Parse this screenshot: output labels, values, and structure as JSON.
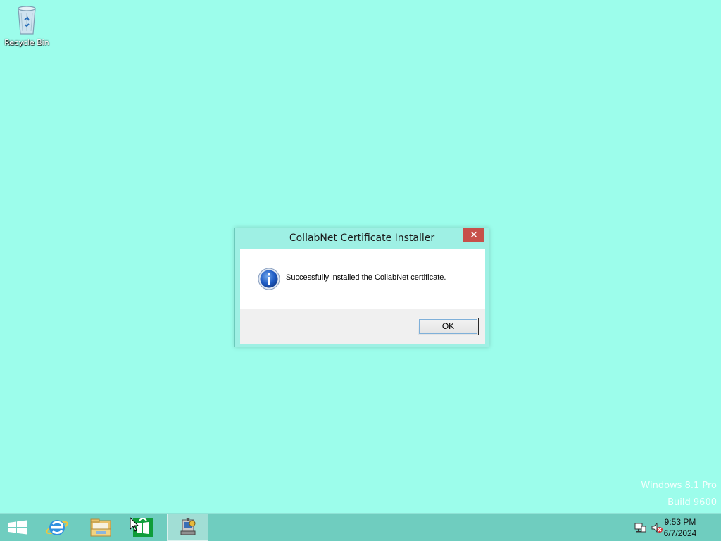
{
  "desktop": {
    "icons": [
      {
        "label": "Recycle Bin",
        "icon": "recycle-bin-icon"
      }
    ],
    "background_color": "#9cfdeb",
    "watermark": {
      "line1": "Windows 8.1 Pro",
      "line2": "Build 9600"
    }
  },
  "dialog": {
    "title": "CollabNet Certificate Installer",
    "close_label": "✕",
    "message": "Successfully installed the CollabNet certificate.",
    "icon": "info-icon",
    "ok_label": "OK"
  },
  "taskbar": {
    "buttons": [
      {
        "name": "start",
        "icon": "windows-logo-icon"
      },
      {
        "name": "internet-explorer",
        "icon": "internet-explorer-icon"
      },
      {
        "name": "file-explorer",
        "icon": "folder-icon"
      },
      {
        "name": "store",
        "icon": "store-icon"
      },
      {
        "name": "certificate-installer",
        "icon": "installer-icon",
        "active": true
      }
    ],
    "tray": {
      "icons": [
        "network-icon",
        "volume-muted-icon"
      ],
      "time": "9:53 PM",
      "date": "6/7/2024"
    }
  },
  "colors": {
    "accent_close": "#c7504a",
    "taskbar": "#6fcdbf",
    "dialog_frame": "#9ef0e4"
  }
}
